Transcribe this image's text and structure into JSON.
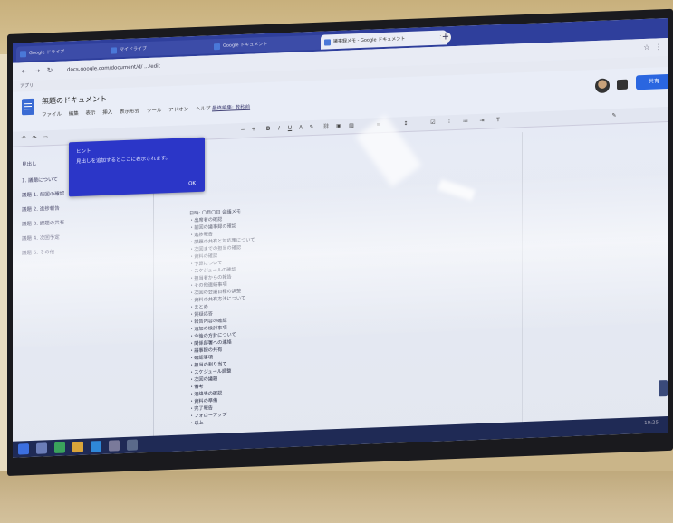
{
  "browser": {
    "tabs": [
      {
        "label": "Google ドライブ"
      },
      {
        "label": "マイドライブ"
      },
      {
        "label": "Google ドキュメント"
      },
      {
        "label": "議事録メモ - Google ドキュメント"
      }
    ],
    "new_tab_label": "+",
    "url": "docs.google.com/document/d/ .../edit",
    "bookmarks_label": "アプリ"
  },
  "docs": {
    "title": "無題のドキュメント",
    "menu": [
      "ファイル",
      "編集",
      "表示",
      "挿入",
      "表示形式",
      "ツール",
      "アドオン",
      "ヘルプ"
    ],
    "last_edit": "最終編集: 数秒前",
    "share_label": "共有"
  },
  "popup": {
    "title": "ヒント",
    "body": "見出しを追加するとここに表示されます。",
    "ok_label": "OK"
  },
  "outline": {
    "items": [
      "見出し",
      "1. 議題について",
      "議題 1. 前回の確認",
      "議題 2. 進捗報告",
      "議題 3. 課題の共有",
      "議題 4. 次回予定",
      "議題 5. その他"
    ]
  },
  "document": {
    "lines": [
      "日時: 〇月〇日 会議メモ",
      "・出席者の確認",
      "・前回の議事録の確認",
      "・進捗報告",
      "・課題の共有と対応策について",
      "・次回までの担当の確認",
      "・資料の確認",
      "・予算について",
      "・スケジュールの確認",
      "・担当者からの報告",
      "・その他連絡事項",
      "・次回の会議日程の調整",
      "・資料の共有方法について",
      "・まとめ",
      "・質疑応答",
      "・報告内容の確認",
      "・追加の検討事項",
      "・今後の方針について",
      "・関係部署への連絡",
      "・議事録の共有",
      "・確認事項",
      "・担当の割り当て",
      "・スケジュール調整",
      "・次回の議題",
      "・備考",
      "・連絡先の確認",
      "・資料の準備",
      "・完了報告",
      "・フォローアップ",
      "・以上"
    ]
  },
  "taskbar": {
    "clock": "10:25"
  },
  "colors": {
    "tab_bar": "#2f3f9c",
    "popup": "#2b36c8",
    "share": "#2a66e0",
    "taskbar": "#1f2a55"
  }
}
